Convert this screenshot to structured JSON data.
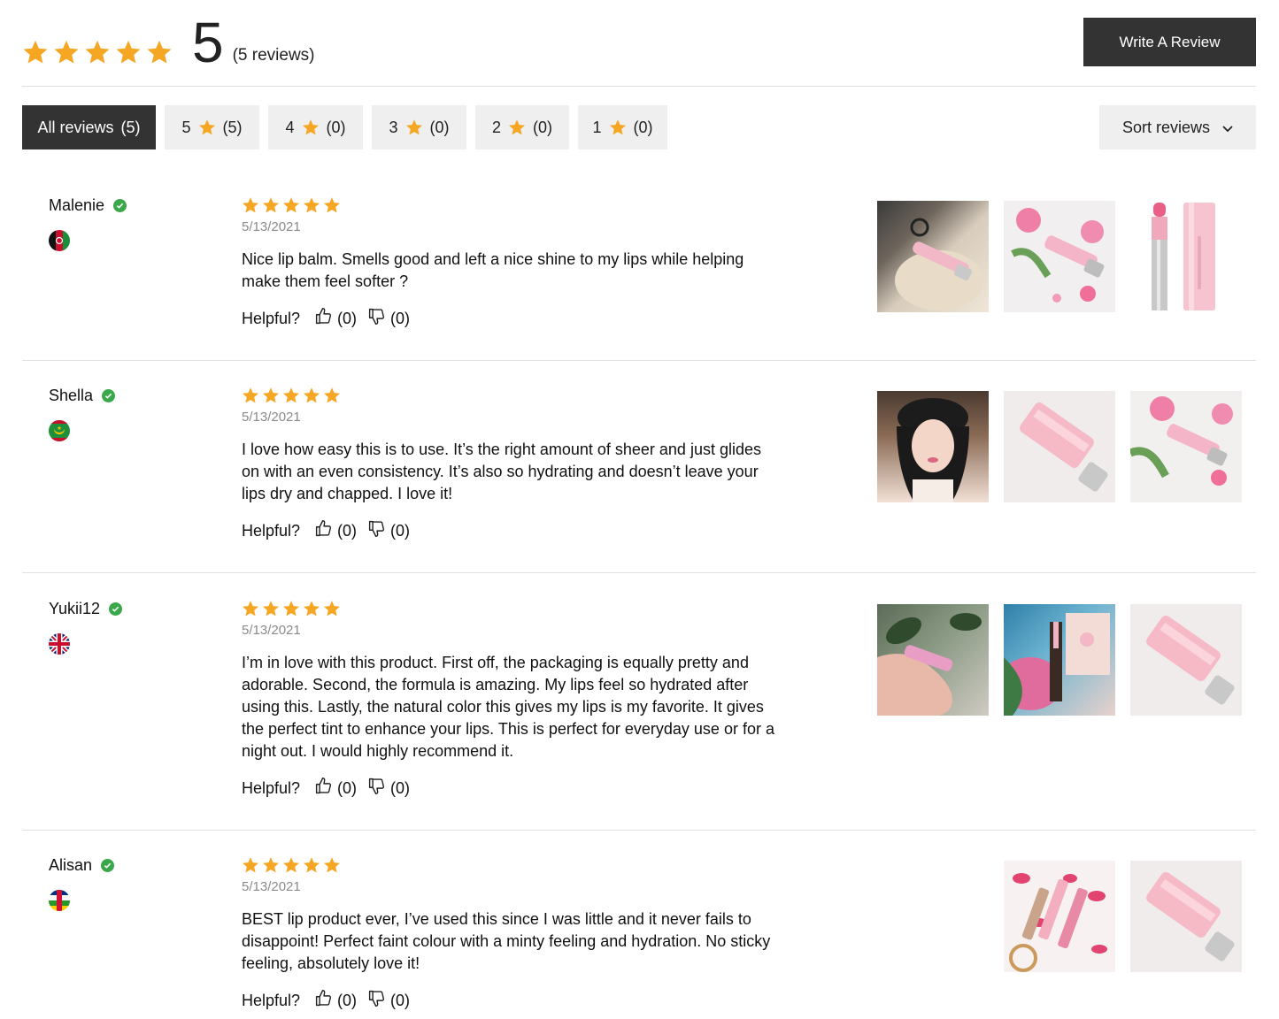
{
  "summary": {
    "score": "5",
    "count_label": "(5 reviews)",
    "stars": 5,
    "star_color": "#f5a623"
  },
  "write_review_label": "Write A Review",
  "filters": [
    {
      "label": "All reviews",
      "count": "(5)",
      "active": true
    },
    {
      "label": "5",
      "count": "(5)",
      "star": true
    },
    {
      "label": "4",
      "count": "(0)",
      "star": true
    },
    {
      "label": "3",
      "count": "(0)",
      "star": true
    },
    {
      "label": "2",
      "count": "(0)",
      "star": true
    },
    {
      "label": "1",
      "count": "(0)",
      "star": true
    }
  ],
  "sort_label": "Sort reviews",
  "helpful_label": "Helpful?",
  "reviews": [
    {
      "author": "Malenie",
      "verified": true,
      "flag": "afghanistan-flag",
      "rating": 5,
      "date": "5/13/2021",
      "text": "Nice lip balm. Smells good and left a nice shine to my lips while helping make them feel softer ?",
      "upvotes": "(0)",
      "downvotes": "(0)",
      "photos": [
        "lip-balm-on-knit-sweater-photo",
        "lip-balm-with-pink-roses-photo",
        "lip-balm-uncapped-photo"
      ]
    },
    {
      "author": "Shella",
      "verified": true,
      "flag": "mauritania-flag",
      "rating": 5,
      "date": "5/13/2021",
      "text": "I love how easy this is to use. It’s the right amount of sheer and just glides on with an even consistency. It’s also so hydrating and doesn’t leave your lips dry and chapped. I love it!",
      "upvotes": "(0)",
      "downvotes": "(0)",
      "photos": [
        "reviewer-selfie-photo",
        "pink-lip-balm-tube-photo",
        "lip-balm-with-roses-photo"
      ]
    },
    {
      "author": "Yukii12",
      "verified": true,
      "flag": "united-kingdom-flag",
      "rating": 5,
      "date": "5/13/2021",
      "text": "I’m in love with this product. First off, the packaging is equally pretty and adorable. Second, the formula is amazing. My lips feel so hydrated after using this. Lastly, the natural color this gives my lips is my favorite. It gives the perfect tint to enhance your lips. This is perfect for everyday use or for a night out. I would highly recommend it.",
      "upvotes": "(0)",
      "downvotes": "(0)",
      "photos": [
        "lip-balm-in-hand-photo",
        "lip-balm-with-flowers-photo",
        "pink-lip-balm-tube-photo"
      ]
    },
    {
      "author": "Alisan",
      "verified": true,
      "flag": "central-african-republic-flag",
      "rating": 5,
      "date": "5/13/2021",
      "text": "BEST lip product ever, I’ve used this since I was little and it never fails to disappoint! Perfect faint colour with a minty feeling and hydration. No sticky feeling, absolutely love it!",
      "upvotes": "(0)",
      "downvotes": "(0)",
      "photos": [
        "lip-balms-with-kiss-prints-photo",
        "pink-lip-balm-tube-photo"
      ]
    }
  ]
}
